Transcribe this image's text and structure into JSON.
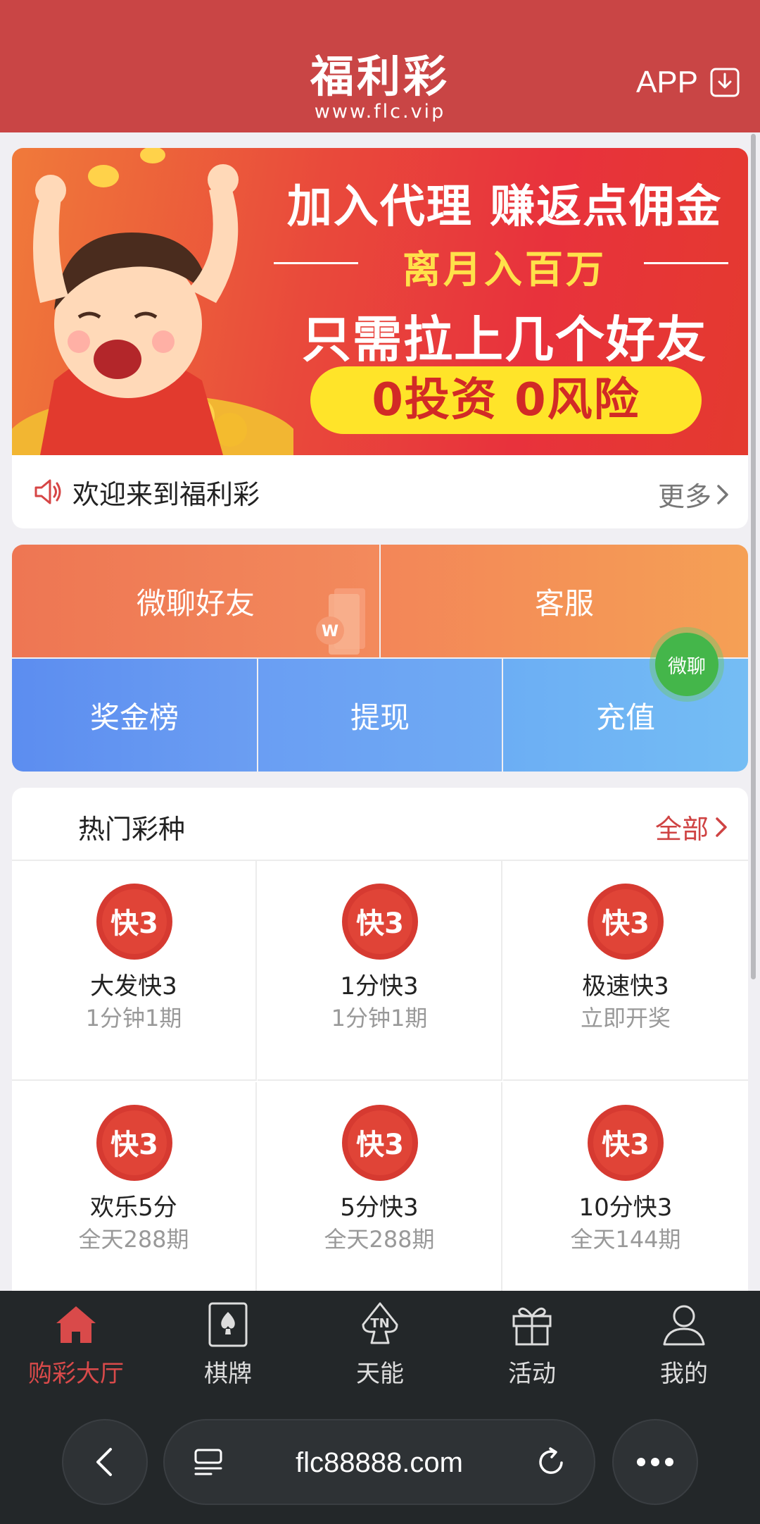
{
  "header": {
    "logo_main": "福利彩",
    "logo_sub": "www.flc.vip",
    "app_label": "APP"
  },
  "banner": {
    "line1": "加入代理 赚返点佣金",
    "line2": "离月入百万",
    "line3": "只需拉上几个好友",
    "pill": "0投资 0风险"
  },
  "notice": {
    "text": "欢迎来到福利彩",
    "more": "更多"
  },
  "quick": {
    "wechat_friends": "微聊好友",
    "service": "客服",
    "leaderboard": "奖金榜",
    "withdraw": "提现",
    "deposit": "充值"
  },
  "float_chat": "微聊",
  "hot": {
    "title": "热门彩种",
    "all": "全部",
    "games": [
      {
        "name": "大发快3",
        "desc": "1分钟1期"
      },
      {
        "name": "1分快3",
        "desc": "1分钟1期"
      },
      {
        "name": "极速快3",
        "desc": "立即开奖"
      },
      {
        "name": "欢乐5分",
        "desc": "全天288期"
      },
      {
        "name": "5分快3",
        "desc": "全天288期"
      },
      {
        "name": "10分快3",
        "desc": "全天144期"
      }
    ]
  },
  "tabs": [
    {
      "label": "购彩大厅",
      "icon": "home-icon"
    },
    {
      "label": "棋牌",
      "icon": "card-icon"
    },
    {
      "label": "天能",
      "icon": "tn-icon"
    },
    {
      "label": "活动",
      "icon": "gift-icon"
    },
    {
      "label": "我的",
      "icon": "user-icon"
    }
  ],
  "browser": {
    "url": "flc88888.com"
  },
  "colors": {
    "brand_red": "#c94545",
    "active_tab": "#d94a4a"
  }
}
